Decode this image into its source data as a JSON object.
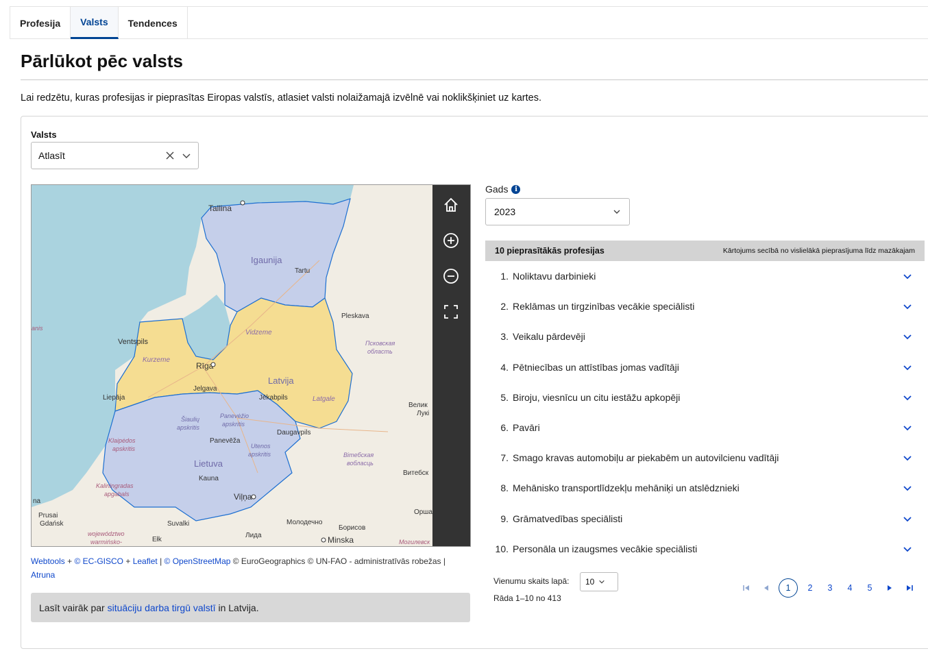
{
  "tabs": [
    {
      "label": "Profesija",
      "active": false
    },
    {
      "label": "Valsts",
      "active": true
    },
    {
      "label": "Tendences",
      "active": false
    }
  ],
  "page": {
    "title": "Pārlūkot pēc valsts",
    "intro": "Lai redzētu, kuras profesijas ir pieprasītas Eiropas valstīs, atlasiet valsti nolaižamajā izvēlnē vai noklikšķiniet uz kartes."
  },
  "country_select": {
    "label": "Valsts",
    "value": "Atlasīt",
    "icons": [
      "close-icon",
      "chevron-down-icon"
    ]
  },
  "map": {
    "labels": {
      "tallinn": "Tallina",
      "estonia": "Igaunija",
      "tartu": "Tartu",
      "pskov": "Pleskava",
      "pskov_oblast_1": "Псковская",
      "pskov_oblast_2": "область",
      "ventspils": "Ventspils",
      "kurzeme": "Kurzeme",
      "vidzeme": "Vidzeme",
      "riga": "Rīga",
      "latvia": "Latvija",
      "jelgava": "Jelgava",
      "jekabpils": "Jēkabpils",
      "latgale": "Latgale",
      "liepaja": "Liepāja",
      "siauliai_1": "Šiaulių",
      "siauliai_2": "apskritis",
      "panevezys_ap_1": "Panevėžio",
      "panevezys_ap_2": "apskritis",
      "panevezys": "Panevēža",
      "daugavpils": "Daugavpils",
      "klaipeda_1": "Klaipėdos",
      "klaipeda_2": "apskritis",
      "utena_1": "Utenos",
      "utena_2": "apskritis",
      "lithuania": "Lietuva",
      "kaunas": "Kauna",
      "vitebsk_ob_1": "Вітебская",
      "vitebsk_ob_2": "вобласць",
      "vitebsk": "Витебск",
      "kaliningrad_1": "Kaliningradas",
      "kaliningrad_2": "apgabals",
      "vilnius": "Viļņa",
      "prussia": "Prusai",
      "gdansk": "Gdańsk",
      "suvalki": "Suvalki",
      "molodechno": "Молодечно",
      "borisov": "Борисов",
      "orsha": "Орша",
      "woj_1": "województwo",
      "woj_2": "warmińsko-",
      "elk": "Ełk",
      "lida": "Лида",
      "minsk": "Minska",
      "velikie_1": "Велик",
      "velikie_2": "Лукі",
      "mogilev": "Могилевск",
      "na": "na",
      "janis": "anis"
    },
    "tools": [
      "home-icon",
      "zoom-in-icon",
      "zoom-out-icon",
      "fullscreen-icon"
    ],
    "colors": {
      "sea": "#aad3df",
      "estonia": "#c5cfea",
      "latvia": "#f5dd92",
      "lithuania": "#c5cfea",
      "border": "#1d6fd1",
      "land": "#f1ede4"
    }
  },
  "attribution": {
    "webtools": "Webtools",
    "sep1": " + ",
    "ec_gisco": "© EC-GISCO",
    "sep2": " + ",
    "leaflet": "Leaflet",
    "sep3": " | ",
    "osm": "© OpenStreetMap",
    "rest": " © EuroGeographics © UN-FAO - administratīvās robežas |",
    "atruna": "Atruna"
  },
  "readmore": {
    "prefix": "Lasīt vairāk par ",
    "link": "situāciju darba tirgū valstī",
    "suffix": " in Latvija."
  },
  "year": {
    "label": "Gads",
    "value": "2023"
  },
  "occupations": {
    "header_title": "10 pieprasītākās profesijas",
    "header_sort": "Kārtojums secībā no vislielākā pieprasījuma līdz mazākajam",
    "items": [
      {
        "num": "1.",
        "name": "Noliktavu darbinieki"
      },
      {
        "num": "2.",
        "name": "Reklāmas un tirgzinības vecākie speciālisti"
      },
      {
        "num": "3.",
        "name": "Veikalu pārdevēji"
      },
      {
        "num": "4.",
        "name": "Pētniecības un attīstības jomas vadītāji"
      },
      {
        "num": "5.",
        "name": "Biroju, viesnīcu un citu iestāžu apkopēji"
      },
      {
        "num": "6.",
        "name": "Pavāri"
      },
      {
        "num": "7.",
        "name": "Smago kravas automobiļu ar piekabēm un autovilcienu vadītāji"
      },
      {
        "num": "8.",
        "name": "Mehānisko transportlīdzekļu mehāniķi un atslēdznieki"
      },
      {
        "num": "9.",
        "name": "Grāmatvedības speciālisti"
      },
      {
        "num": "10.",
        "name": "Personāla un izaugsmes vecākie speciālisti"
      }
    ]
  },
  "pagination": {
    "per_page_label": "Vienumu skaits lapā:",
    "per_page_value": "10",
    "range_text": "Rāda 1–10 no 413",
    "pages": [
      "1",
      "2",
      "3",
      "4",
      "5"
    ],
    "current_page": "1"
  }
}
